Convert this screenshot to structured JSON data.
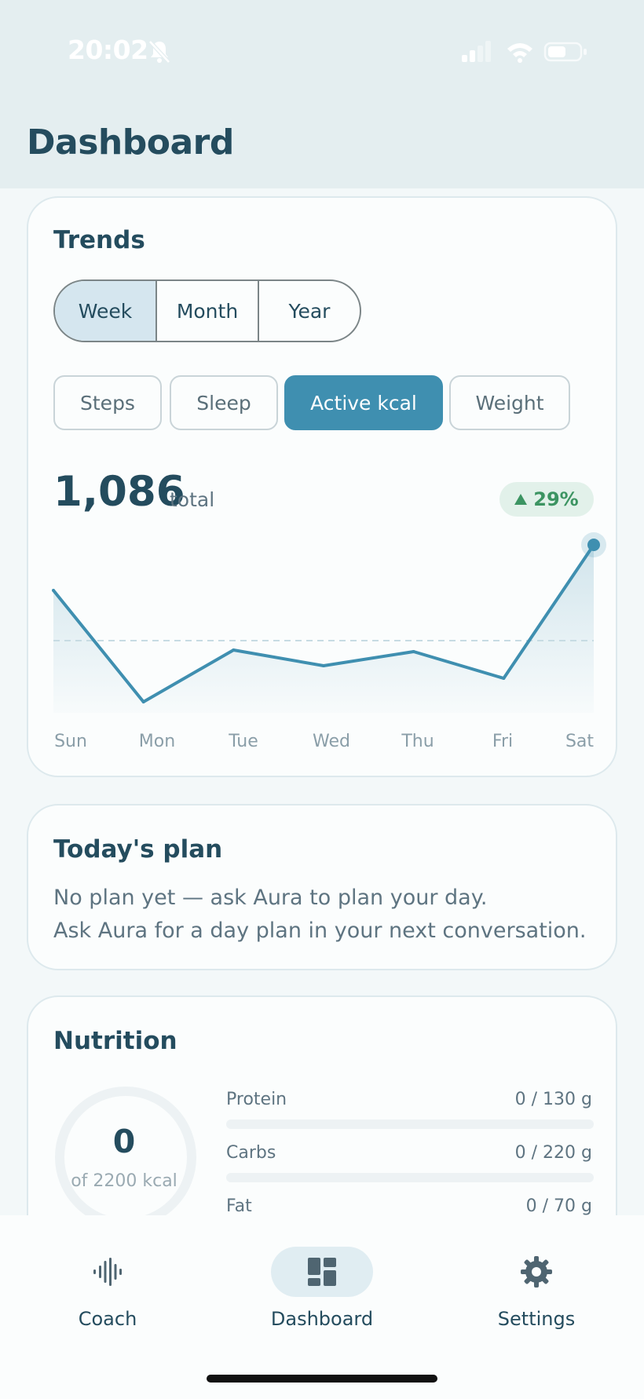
{
  "status_bar": {
    "time": "20:02"
  },
  "header": {
    "title": "Dashboard"
  },
  "trends": {
    "title": "Trends",
    "ranges": [
      "Week",
      "Month",
      "Year"
    ],
    "selected_range": "Week",
    "metrics": [
      "Steps",
      "Sleep",
      "Active kcal",
      "Weight"
    ],
    "selected_metric": "Active kcal",
    "total_value": "1,086",
    "total_label": "total",
    "delta": "29%",
    "delta_color": "#3c9462",
    "line_color": "#3f8fb0"
  },
  "chart_data": {
    "type": "area",
    "categories": [
      "Sun",
      "Mon",
      "Tue",
      "Wed",
      "Thu",
      "Fri",
      "Sat"
    ],
    "values": [
      0.71,
      0.0,
      0.33,
      0.23,
      0.32,
      0.15,
      1.0
    ],
    "reference_value": 0.39,
    "highlight_index": 6,
    "grid": false
  },
  "plan": {
    "title": "Today's plan",
    "line1": "No plan yet — ask Aura to plan your day.",
    "line2": "Ask Aura for a day plan in your next conversation."
  },
  "nutrition": {
    "title": "Nutrition",
    "calories_value": "0",
    "calories_label": "of 2200 kcal",
    "macros": [
      {
        "name": "Protein",
        "value": "0 / 130 g",
        "progress": 0
      },
      {
        "name": "Carbs",
        "value": "0 / 220 g",
        "progress": 0
      },
      {
        "name": "Fat",
        "value": "0 / 70 g",
        "progress": 0
      }
    ]
  },
  "tabbar": {
    "tabs": [
      {
        "label": "Coach",
        "icon": "waveform-icon"
      },
      {
        "label": "Dashboard",
        "icon": "dashboard-grid-icon"
      },
      {
        "label": "Settings",
        "icon": "gear-icon"
      }
    ],
    "active": "Dashboard"
  }
}
